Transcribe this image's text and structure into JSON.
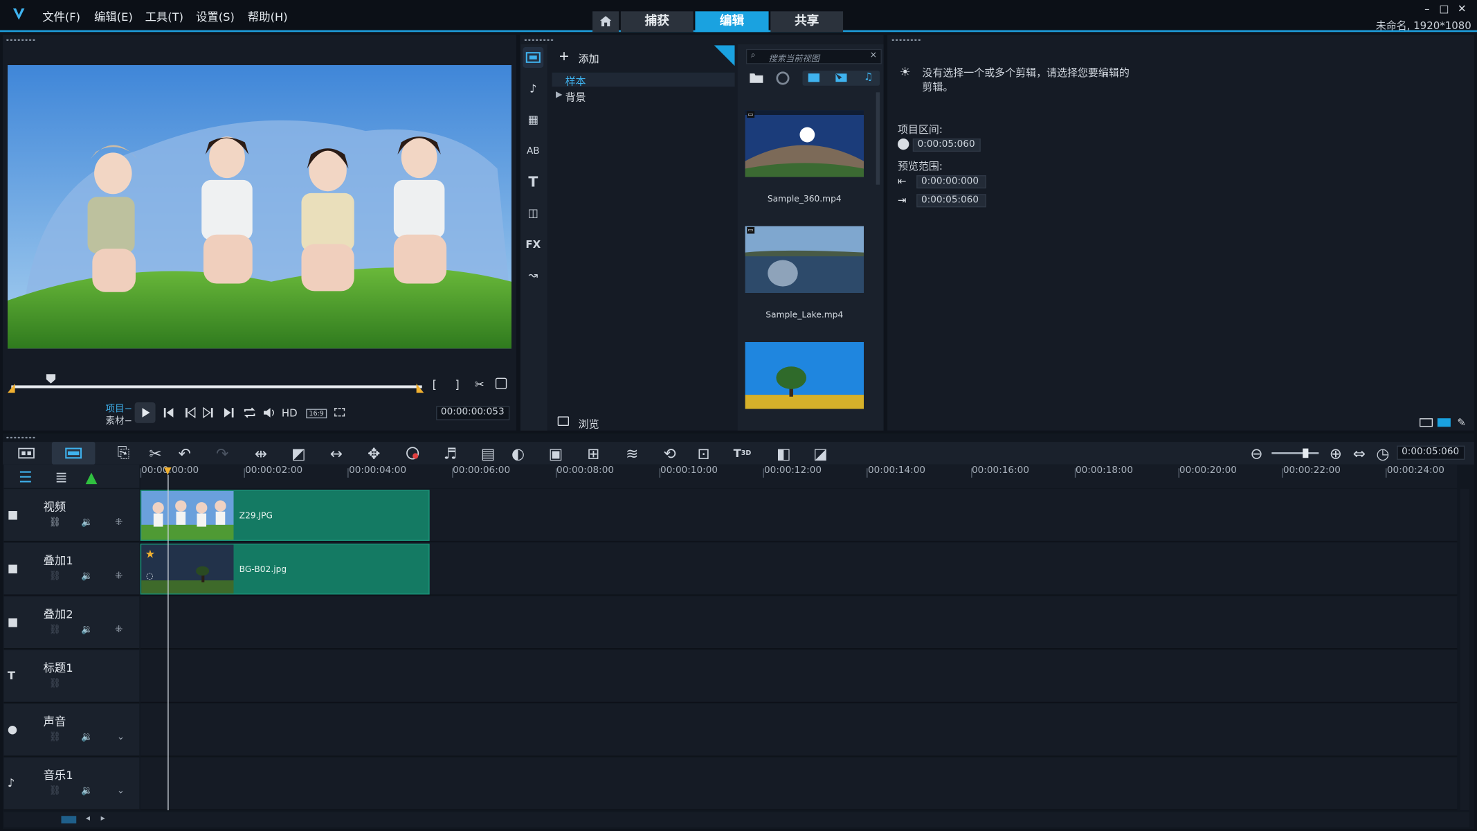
{
  "app": {
    "title_info": "未命名, 1920*1080",
    "menu": [
      "文件(F)",
      "编辑(E)",
      "工具(T)",
      "设置(S)",
      "帮助(H)"
    ],
    "mode_tabs": [
      "捕获",
      "编辑",
      "共享"
    ],
    "active_tab": "编辑",
    "accent_color": "#1aa2e0"
  },
  "player": {
    "mode_project": "项目−",
    "mode_clip": "素材−",
    "hd_label": "HD",
    "aspect_label": "16:9",
    "timecode": "00:00:00:053"
  },
  "library": {
    "add_label": "添加",
    "tree": [
      "样本",
      "背景"
    ],
    "search_placeholder": "搜索当前视图",
    "browse_label": "浏览",
    "thumbnails": [
      "Sample_360.mp4",
      "Sample_Lake.mp4",
      ""
    ]
  },
  "options": {
    "hint": "没有选择一个或多个剪辑，请选择您要编辑的剪辑。",
    "project_duration_label": "项目区间:",
    "project_duration": "0:00:05:060",
    "preview_range_label": "预览范围:",
    "range_start": "0:00:00:000",
    "range_end": "0:00:05:060"
  },
  "timeline": {
    "duration": "0:00:05:060",
    "ruler": [
      "00:00:00:00",
      "00:00:02:00",
      "00:00:04:00",
      "00:00:06:00",
      "00:00:08:00",
      "00:00:10:00",
      "00:00:12:00",
      "00:00:14:00",
      "00:00:16:00",
      "00:00:18:00",
      "00:00:20:00",
      "00:00:22:00",
      "00:00:24:00"
    ],
    "tracks": [
      {
        "name": "视频",
        "clip": "Z29.JPG"
      },
      {
        "name": "叠加1",
        "clip": "BG-B02.jpg"
      },
      {
        "name": "叠加2",
        "clip": ""
      },
      {
        "name": "标题1",
        "clip": ""
      },
      {
        "name": "声音",
        "clip": ""
      },
      {
        "name": "音乐1",
        "clip": ""
      }
    ]
  }
}
